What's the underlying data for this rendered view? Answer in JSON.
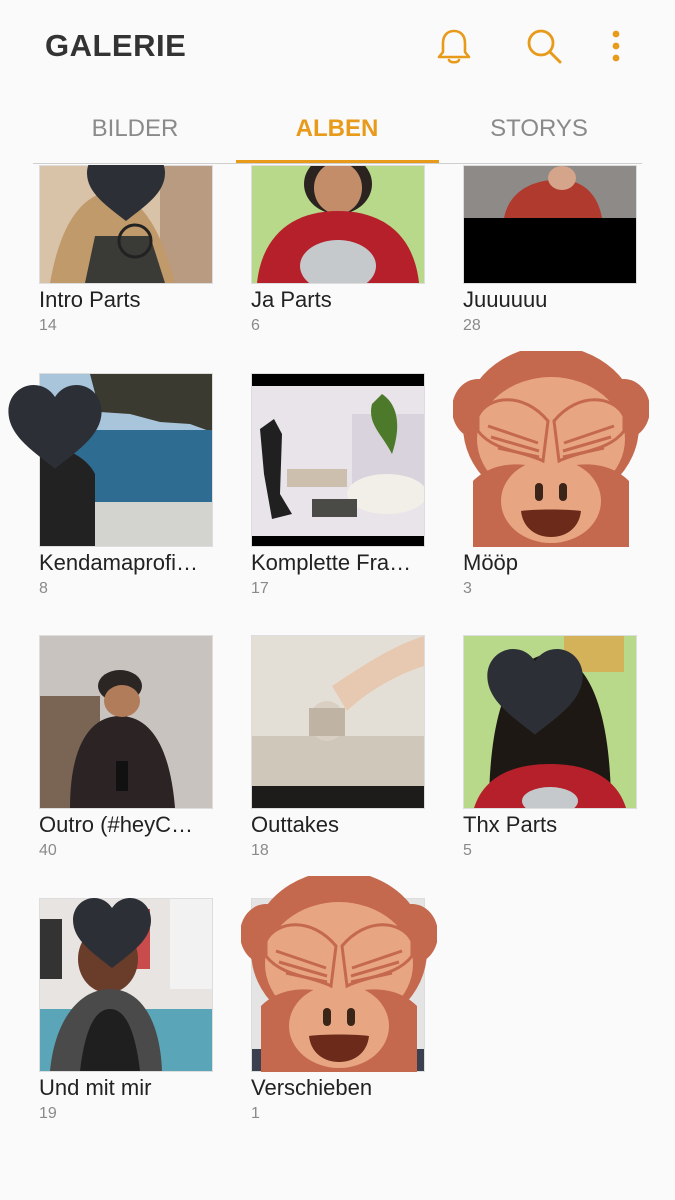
{
  "app": {
    "title": "GALERIE"
  },
  "actions": [
    {
      "name": "notifications",
      "icon": "bell-icon"
    },
    {
      "name": "search",
      "icon": "search-icon"
    },
    {
      "name": "more",
      "icon": "more-vertical-icon"
    }
  ],
  "colors": {
    "accent": "#e89a1a",
    "text": "#222222",
    "muted": "#8a8a8a",
    "background": "#fafafa"
  },
  "tabs": [
    {
      "label": "BILDER",
      "active": false
    },
    {
      "label": "ALBEN",
      "active": true
    },
    {
      "label": "STORYS",
      "active": false
    }
  ],
  "albums": [
    {
      "name": "Intro Parts",
      "count": "14"
    },
    {
      "name": "Ja Parts",
      "count": "6"
    },
    {
      "name": "Juuuuuu",
      "count": "28"
    },
    {
      "name": "Kendamaprofi…",
      "count": "8"
    },
    {
      "name": "Komplette Fra…",
      "count": "17"
    },
    {
      "name": "Mööp",
      "count": "3"
    },
    {
      "name": "Outro (#heyC…",
      "count": "40"
    },
    {
      "name": "Outtakes",
      "count": "18"
    },
    {
      "name": "Thx Parts",
      "count": "5"
    },
    {
      "name": "Und mit mir",
      "count": "19"
    },
    {
      "name": "Verschieben",
      "count": "1"
    }
  ]
}
